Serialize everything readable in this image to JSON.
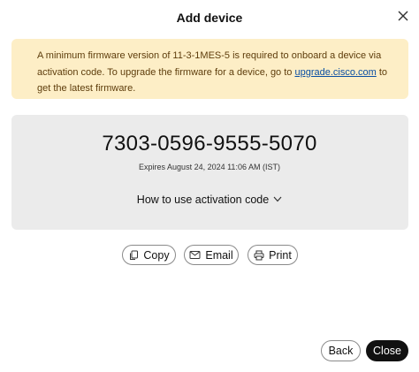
{
  "dialog": {
    "title": "Add device",
    "close_icon": "close-icon"
  },
  "banner": {
    "text_before_link": "A minimum firmware version of 11-3-1MES-5 is required to onboard a device via activation code. To upgrade the firmware for a device, go to ",
    "link_text": "upgrade.cisco.com",
    "text_after_link": " to get the latest firmware.",
    "background_color": "#fdeec6",
    "text_color": "#5e3d0c",
    "link_color": "#0a4ea3"
  },
  "activation": {
    "code": "7303-0596-9555-5070",
    "expires": "Expires August 24, 2024 11:06 AM (IST)",
    "howto_label": "How to use activation code",
    "howto_icon": "chevron-down-icon"
  },
  "actions": {
    "copy_label": "Copy",
    "copy_icon": "copy-icon",
    "email_label": "Email",
    "email_icon": "mail-icon",
    "print_label": "Print",
    "print_icon": "printer-icon"
  },
  "footer": {
    "back_label": "Back",
    "close_label": "Close",
    "primary_color": "#111111"
  }
}
